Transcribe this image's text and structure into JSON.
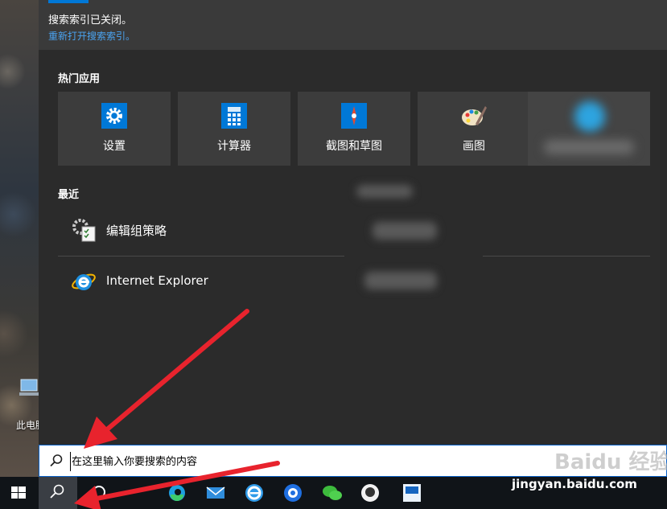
{
  "desktop": {
    "pc_label": "此电脑"
  },
  "notice": {
    "text": "搜索索引已关闭。",
    "link": "重新打开搜索索引。"
  },
  "hot_apps": {
    "title": "热门应用",
    "items": [
      {
        "label": "设置",
        "icon": "settings-icon"
      },
      {
        "label": "计算器",
        "icon": "calculator-icon"
      },
      {
        "label": "截图和草图",
        "icon": "snip-sketch-icon"
      },
      {
        "label": "画图",
        "icon": "paint-icon"
      }
    ]
  },
  "recent": {
    "title": "最近",
    "items": [
      {
        "label": "编辑组策略",
        "icon": "group-policy-icon"
      },
      {
        "label": "Internet Explorer",
        "icon": "internet-explorer-icon"
      }
    ]
  },
  "search": {
    "placeholder": "在这里输入你要搜索的内容",
    "value": ""
  },
  "watermark": {
    "logo": "Baidu 经验",
    "url": "jingyan.baidu.com"
  },
  "taskbar": {
    "items": [
      "windows-start-icon",
      "search-icon",
      "cortana-icon",
      "edge-icon",
      "mail-icon",
      "browser-e-icon",
      "qq-browser-icon",
      "wechat-icon",
      "avatar-app-icon",
      "news-app-icon"
    ]
  },
  "colors": {
    "accent": "#0078d7",
    "annotation_arrow": "#e8232d"
  }
}
